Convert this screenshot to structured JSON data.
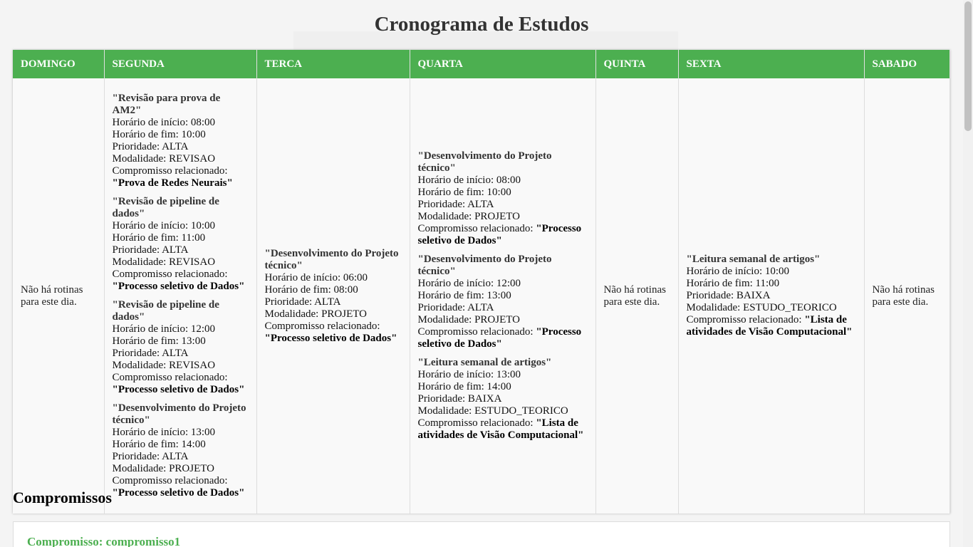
{
  "page_title": "Cronograma de Estudos",
  "colors": {
    "header_green": "#4caf50",
    "commitment_title": "#4caf50"
  },
  "days": [
    {
      "name": "DOMINGO",
      "empty": "Não há rotinas para este dia.",
      "routines": []
    },
    {
      "name": "SEGUNDA",
      "empty": "",
      "routines": [
        {
          "title": "\"Revisão para prova de AM2\"",
          "start": "Horário de início: 08:00",
          "end": "Horário de fim: 10:00",
          "priority": "Prioridade: ALTA",
          "mode": "Modalidade: REVISAO",
          "commit_label": "Compromisso relacionado:",
          "commit": "\"Prova de Redes Neurais\""
        },
        {
          "title": "\"Revisão de pipeline de dados\"",
          "start": "Horário de início: 10:00",
          "end": "Horário de fim: 11:00",
          "priority": "Prioridade: ALTA",
          "mode": "Modalidade: REVISAO",
          "commit_label": "Compromisso relacionado:",
          "commit": "\"Processo seletivo de Dados\""
        },
        {
          "title": "\"Revisão de pipeline de dados\"",
          "start": "Horário de início: 12:00",
          "end": "Horário de fim: 13:00",
          "priority": "Prioridade: ALTA",
          "mode": "Modalidade: REVISAO",
          "commit_label": "Compromisso relacionado:",
          "commit": "\"Processo seletivo de Dados\""
        },
        {
          "title": "\"Desenvolvimento do Projeto técnico\"",
          "start": "Horário de início: 13:00",
          "end": "Horário de fim: 14:00",
          "priority": "Prioridade: ALTA",
          "mode": "Modalidade: PROJETO",
          "commit_label": "Compromisso relacionado:",
          "commit": "\"Processo seletivo de Dados\""
        }
      ]
    },
    {
      "name": "TERCA",
      "empty": "",
      "routines": [
        {
          "title": "\"Desenvolvimento do Projeto técnico\"",
          "start": "Horário de início: 06:00",
          "end": "Horário de fim: 08:00",
          "priority": "Prioridade: ALTA",
          "mode": "Modalidade: PROJETO",
          "commit_label": "Compromisso relacionado:",
          "commit": "\"Processo seletivo de Dados\""
        }
      ]
    },
    {
      "name": "QUARTA",
      "empty": "",
      "routines": [
        {
          "title": "\"Desenvolvimento do Projeto técnico\"",
          "start": "Horário de início: 08:00",
          "end": "Horário de fim: 10:00",
          "priority": "Prioridade: ALTA",
          "mode": "Modalidade: PROJETO",
          "commit_label": "Compromisso relacionado:",
          "commit": "\"Processo seletivo de Dados\""
        },
        {
          "title": "\"Desenvolvimento do Projeto técnico\"",
          "start": "Horário de início: 12:00",
          "end": "Horário de fim: 13:00",
          "priority": "Prioridade: ALTA",
          "mode": "Modalidade: PROJETO",
          "commit_label": "Compromisso relacionado:",
          "commit": "\"Processo seletivo de Dados\""
        },
        {
          "title": "\"Leitura semanal de artigos\"",
          "start": "Horário de início: 13:00",
          "end": "Horário de fim: 14:00",
          "priority": "Prioridade: BAIXA",
          "mode": "Modalidade: ESTUDO_TEORICO",
          "commit_label": "Compromisso relacionado:",
          "commit": "\"Lista de atividades de Visão Computacional\""
        }
      ]
    },
    {
      "name": "QUINTA",
      "empty": "Não há rotinas para este dia.",
      "routines": []
    },
    {
      "name": "SEXTA",
      "empty": "",
      "routines": [
        {
          "title": "\"Leitura semanal de artigos\"",
          "start": "Horário de início: 10:00",
          "end": "Horário de fim: 11:00",
          "priority": "Prioridade: BAIXA",
          "mode": "Modalidade: ESTUDO_TEORICO",
          "commit_label": "Compromisso relacionado:",
          "commit": "\"Lista de atividades de Visão Computacional\""
        }
      ]
    },
    {
      "name": "SABADO",
      "empty": "Não há rotinas para este dia.",
      "routines": []
    }
  ],
  "commitments_section": {
    "heading": "Compromissos",
    "items": [
      {
        "title": "Compromisso: compromisso1"
      }
    ]
  }
}
